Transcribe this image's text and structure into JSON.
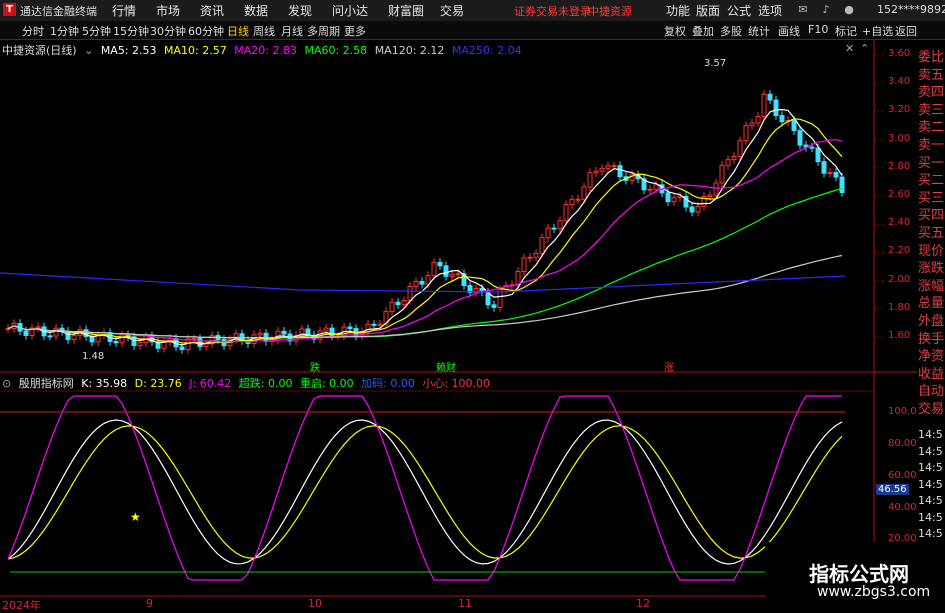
{
  "window": {
    "title": "通达信金融终端",
    "menus": [
      "行情",
      "市场",
      "资讯",
      "数据",
      "发现",
      "问小达",
      "财富圈",
      "交易"
    ],
    "login_status": "证券交易未登录",
    "broker": "中捷资源",
    "right_menus": [
      "功能",
      "版面",
      "公式",
      "选项"
    ],
    "phone": "152****9892"
  },
  "toolbar": {
    "periods": [
      "分时",
      "1分钟",
      "5分钟",
      "15分钟",
      "30分钟",
      "60分钟",
      "日线",
      "周线",
      "月线",
      "多周期",
      "更多"
    ],
    "active_period": "日线",
    "right_buttons": [
      "复权",
      "叠加",
      "多股",
      "统计",
      "画线",
      "F10",
      "标记",
      "+自选",
      "返回"
    ]
  },
  "main_chart": {
    "stock_name": "中捷资源(日线)",
    "ma_labels": [
      {
        "text": "MA5: 2.53",
        "color": "#ffffff"
      },
      {
        "text": "MA10: 2.57",
        "color": "#ffff00"
      },
      {
        "text": "MA20: 2.83",
        "color": "#ff00ff"
      },
      {
        "text": "MA60: 2.58",
        "color": "#00ff00"
      },
      {
        "text": "MA120: 2.12",
        "color": "#cccccc"
      },
      {
        "text": "MA250: 2.04",
        "color": "#3333ff"
      }
    ],
    "y_ticks": [
      "3.60",
      "3.40",
      "3.20",
      "3.00",
      "2.80",
      "2.60",
      "2.40",
      "2.20",
      "2.00",
      "1.80",
      "1.60"
    ],
    "high_label": "3.57",
    "low_label": "1.48",
    "events": [
      {
        "text": "跌",
        "color": "#00ff00"
      },
      {
        "text": "赖财",
        "color": "#00ff00"
      },
      {
        "text": "涨",
        "color": "#ff3030"
      }
    ]
  },
  "indicator": {
    "name": "殷朋指标网",
    "values": [
      {
        "text": "K: 35.98",
        "color": "#ffffff"
      },
      {
        "text": "D: 23.76",
        "color": "#ffff00"
      },
      {
        "text": "J: 60.42",
        "color": "#ff00ff"
      },
      {
        "text": "超跌: 0.00",
        "color": "#00ff00"
      },
      {
        "text": "重启: 0.00",
        "color": "#00ff00"
      },
      {
        "text": "加码: 0.00",
        "color": "#3355ff"
      },
      {
        "text": "小心: 100.00",
        "color": "#ff3030"
      }
    ],
    "y_ticks": [
      "100.0",
      "80.00",
      "60.00",
      "40.00",
      "20.00"
    ],
    "current_value": "46.56"
  },
  "x_axis": [
    "2024年",
    "9",
    "10",
    "11",
    "12"
  ],
  "side_panel": {
    "labels": [
      "委比",
      "卖五",
      "卖四",
      "卖三",
      "卖二",
      "卖一",
      "买一",
      "买二",
      "买三",
      "买四",
      "买五",
      "现价",
      "涨跌",
      "涨幅",
      "总量",
      "外盘",
      "换手",
      "净资",
      "收益",
      "自动",
      "交易"
    ],
    "times": [
      "14:5",
      "14:5",
      "14:5",
      "14:5",
      "14:5",
      "14:5",
      "14:5",
      "14:5",
      "14:5"
    ]
  },
  "watermark": {
    "line1": "指标公式网",
    "line2": "www.zbgs3.com"
  }
}
